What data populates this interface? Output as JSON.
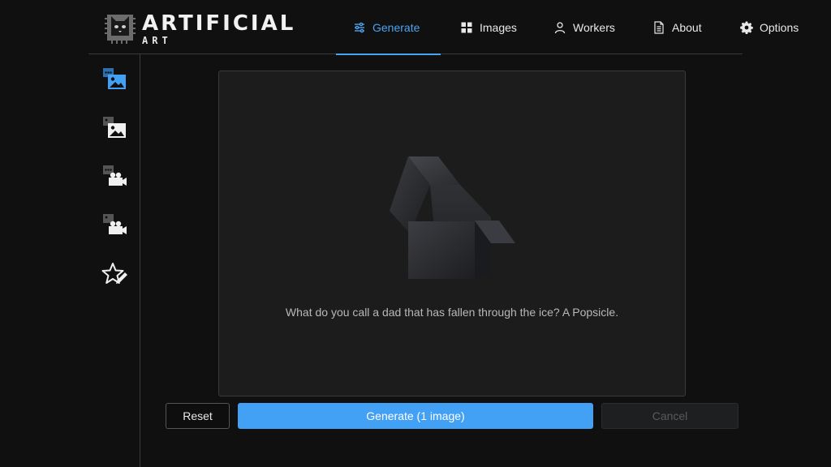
{
  "app": {
    "logo_title": "ARTIFICIAL",
    "logo_subtitle": "ART"
  },
  "nav": [
    {
      "label": "Generate",
      "icon": "sliders-icon",
      "active": true
    },
    {
      "label": "Images",
      "icon": "grid-icon",
      "active": false
    },
    {
      "label": "Workers",
      "icon": "user-icon",
      "active": false
    },
    {
      "label": "About",
      "icon": "document-icon",
      "active": false
    },
    {
      "label": "Options",
      "icon": "gear-icon",
      "active": false
    }
  ],
  "sidebar": [
    {
      "icon": "text-to-image-icon",
      "active": true
    },
    {
      "icon": "image-to-image-icon",
      "active": false
    },
    {
      "icon": "text-to-video-icon",
      "active": false
    },
    {
      "icon": "image-to-video-icon",
      "active": false
    },
    {
      "icon": "star-edit-icon",
      "active": false
    }
  ],
  "preview": {
    "message": "What do you call a dad that has fallen through the ice? A Popsicle."
  },
  "actions": {
    "reset_label": "Reset",
    "generate_label": "Generate (1 image)",
    "cancel_label": "Cancel"
  },
  "colors": {
    "accent": "#42a0f5",
    "active_nav": "#4aa3f0",
    "background": "#101010"
  }
}
